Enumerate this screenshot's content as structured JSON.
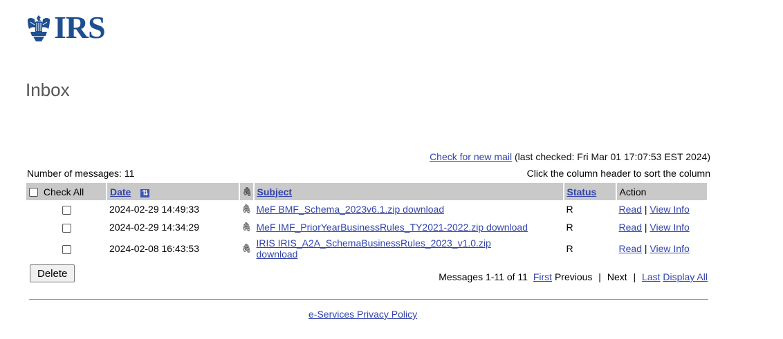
{
  "logo": {
    "text": "IRS"
  },
  "page": {
    "title": "Inbox"
  },
  "mail": {
    "check_link": "Check for new mail",
    "last_checked": "(last checked: Fri Mar 01 17:07:53 EST 2024)",
    "count_label": "Number of messages: 11",
    "sort_hint": "Click the column header to sort the column"
  },
  "table": {
    "headers": {
      "check_all": "Check All",
      "date": "Date",
      "subject": "Subject",
      "status": "Status",
      "action": "Action"
    },
    "rows": [
      {
        "date": "2024-02-29 14:49:33",
        "subject": "MeF BMF_Schema_2023v6.1.zip download",
        "status": "R",
        "read": "Read",
        "sep": "|",
        "view": "View Info"
      },
      {
        "date": "2024-02-29 14:34:29",
        "subject": "MeF IMF_PriorYearBusinessRules_TY2021-2022.zip download",
        "status": "R",
        "read": "Read",
        "sep": "|",
        "view": "View Info"
      },
      {
        "date": "2024-02-08 16:43:53",
        "subject": "IRIS IRIS_A2A_SchemaBusinessRules_2023_v1.0.zip download",
        "status": "R",
        "read": "Read",
        "sep": "|",
        "view": "View Info"
      }
    ]
  },
  "footer": {
    "delete_label": "Delete",
    "pager": {
      "range": "Messages 1-11 of 11",
      "first": "First",
      "previous": "Previous",
      "sep": "|",
      "next": "Next",
      "last": "Last",
      "display_all": "Display All"
    },
    "privacy": "e-Services Privacy Policy"
  },
  "colors": {
    "link": "#3344aa",
    "header_bg": "#c9c9c9",
    "logo": "#1d4f91"
  }
}
